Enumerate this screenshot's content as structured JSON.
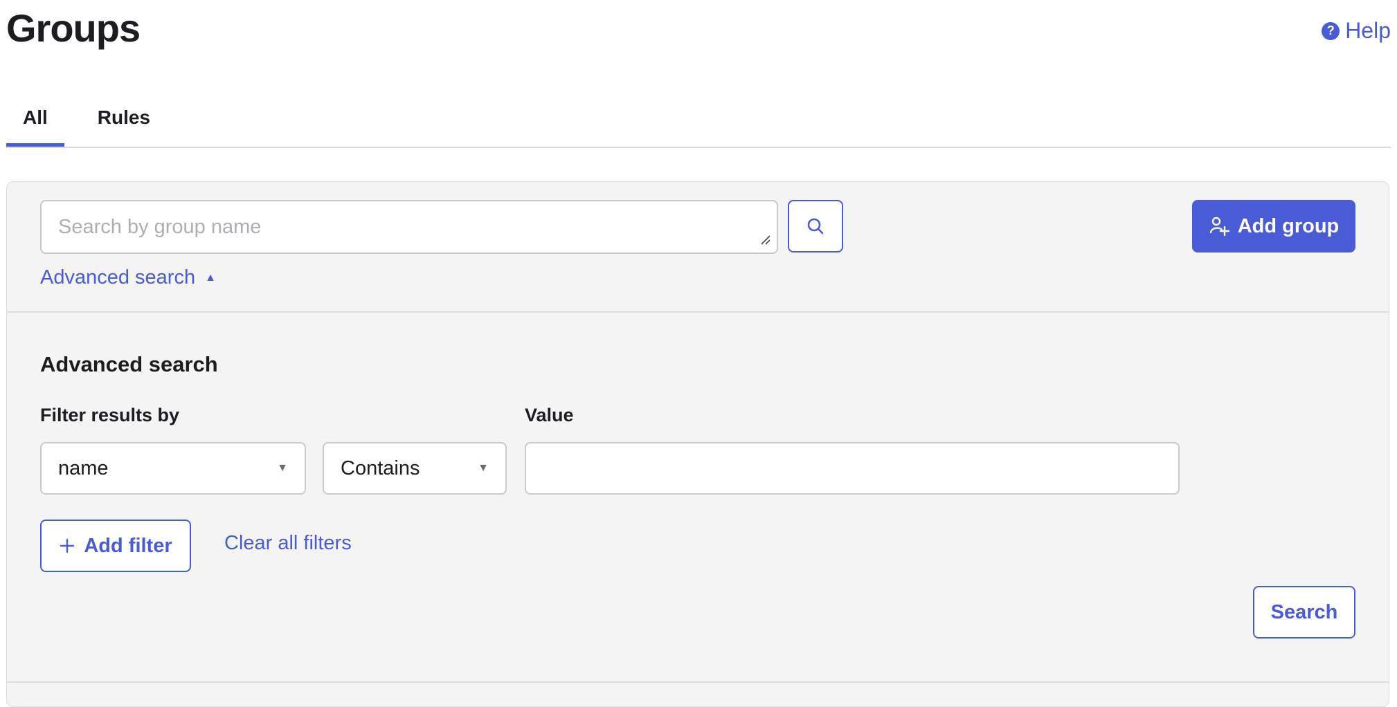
{
  "page": {
    "title": "Groups"
  },
  "help": {
    "label": "Help",
    "icon": "help-circle-icon"
  },
  "tabs": [
    {
      "label": "All",
      "active": true
    },
    {
      "label": "Rules",
      "active": false
    }
  ],
  "search": {
    "placeholder": "Search by group name",
    "value": "",
    "button_icon": "search-icon"
  },
  "actions": {
    "add_group_label": "Add group",
    "add_group_icon": "add-user-icon"
  },
  "advanced_toggle": {
    "label": "Advanced search",
    "caret": "▲"
  },
  "advanced": {
    "title": "Advanced search",
    "filter_label": "Filter results by",
    "value_label": "Value",
    "field_select": {
      "selected": "name"
    },
    "operator_select": {
      "selected": "Contains"
    },
    "value_input": {
      "value": ""
    },
    "add_filter_label": "Add filter",
    "clear_label": "Clear all filters",
    "search_label": "Search"
  },
  "colors": {
    "accent": "#4a5bd6",
    "panel_bg": "#f4f4f4",
    "border": "#c9c9ce",
    "text": "#1d1d21"
  }
}
